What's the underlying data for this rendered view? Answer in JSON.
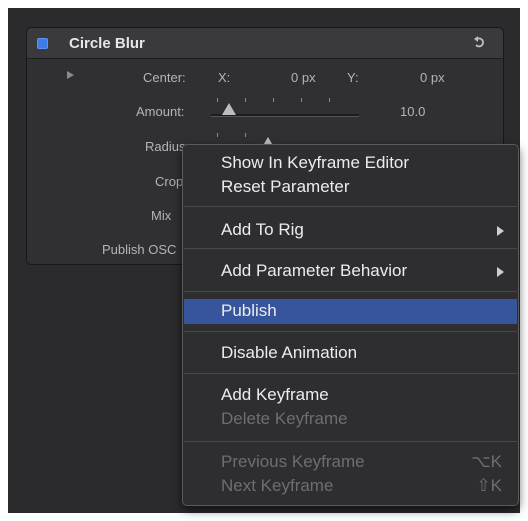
{
  "panel": {
    "title": "Circle Blur",
    "accent": "#3d7be6",
    "rows": {
      "center_label": "Center:",
      "x_label": "X:",
      "x_value": "0 px",
      "y_label": "Y:",
      "y_value": "0 px",
      "amount_label": "Amount:",
      "amount_value": "10.0",
      "radius_label": "Radius",
      "crop_label": "Crop",
      "mix_label": "Mix",
      "publish_osc_label": "Publish OSC"
    }
  },
  "context_menu": {
    "items": [
      {
        "label": "Show In Keyframe Editor",
        "enabled": true
      },
      {
        "label": "Reset Parameter",
        "enabled": true
      },
      {
        "label": "Add To Rig",
        "enabled": true,
        "submenu": true
      },
      {
        "label": "Add Parameter Behavior",
        "enabled": true,
        "submenu": true
      },
      {
        "label": "Publish",
        "enabled": true,
        "highlighted": true
      },
      {
        "label": "Disable Animation",
        "enabled": true
      },
      {
        "label": "Add Keyframe",
        "enabled": true
      },
      {
        "label": "Delete Keyframe",
        "enabled": false
      },
      {
        "label": "Previous Keyframe",
        "enabled": false,
        "shortcut": "⌥K"
      },
      {
        "label": "Next Keyframe",
        "enabled": false,
        "shortcut": "⇧K"
      }
    ],
    "highlight_color": "#37559c"
  }
}
